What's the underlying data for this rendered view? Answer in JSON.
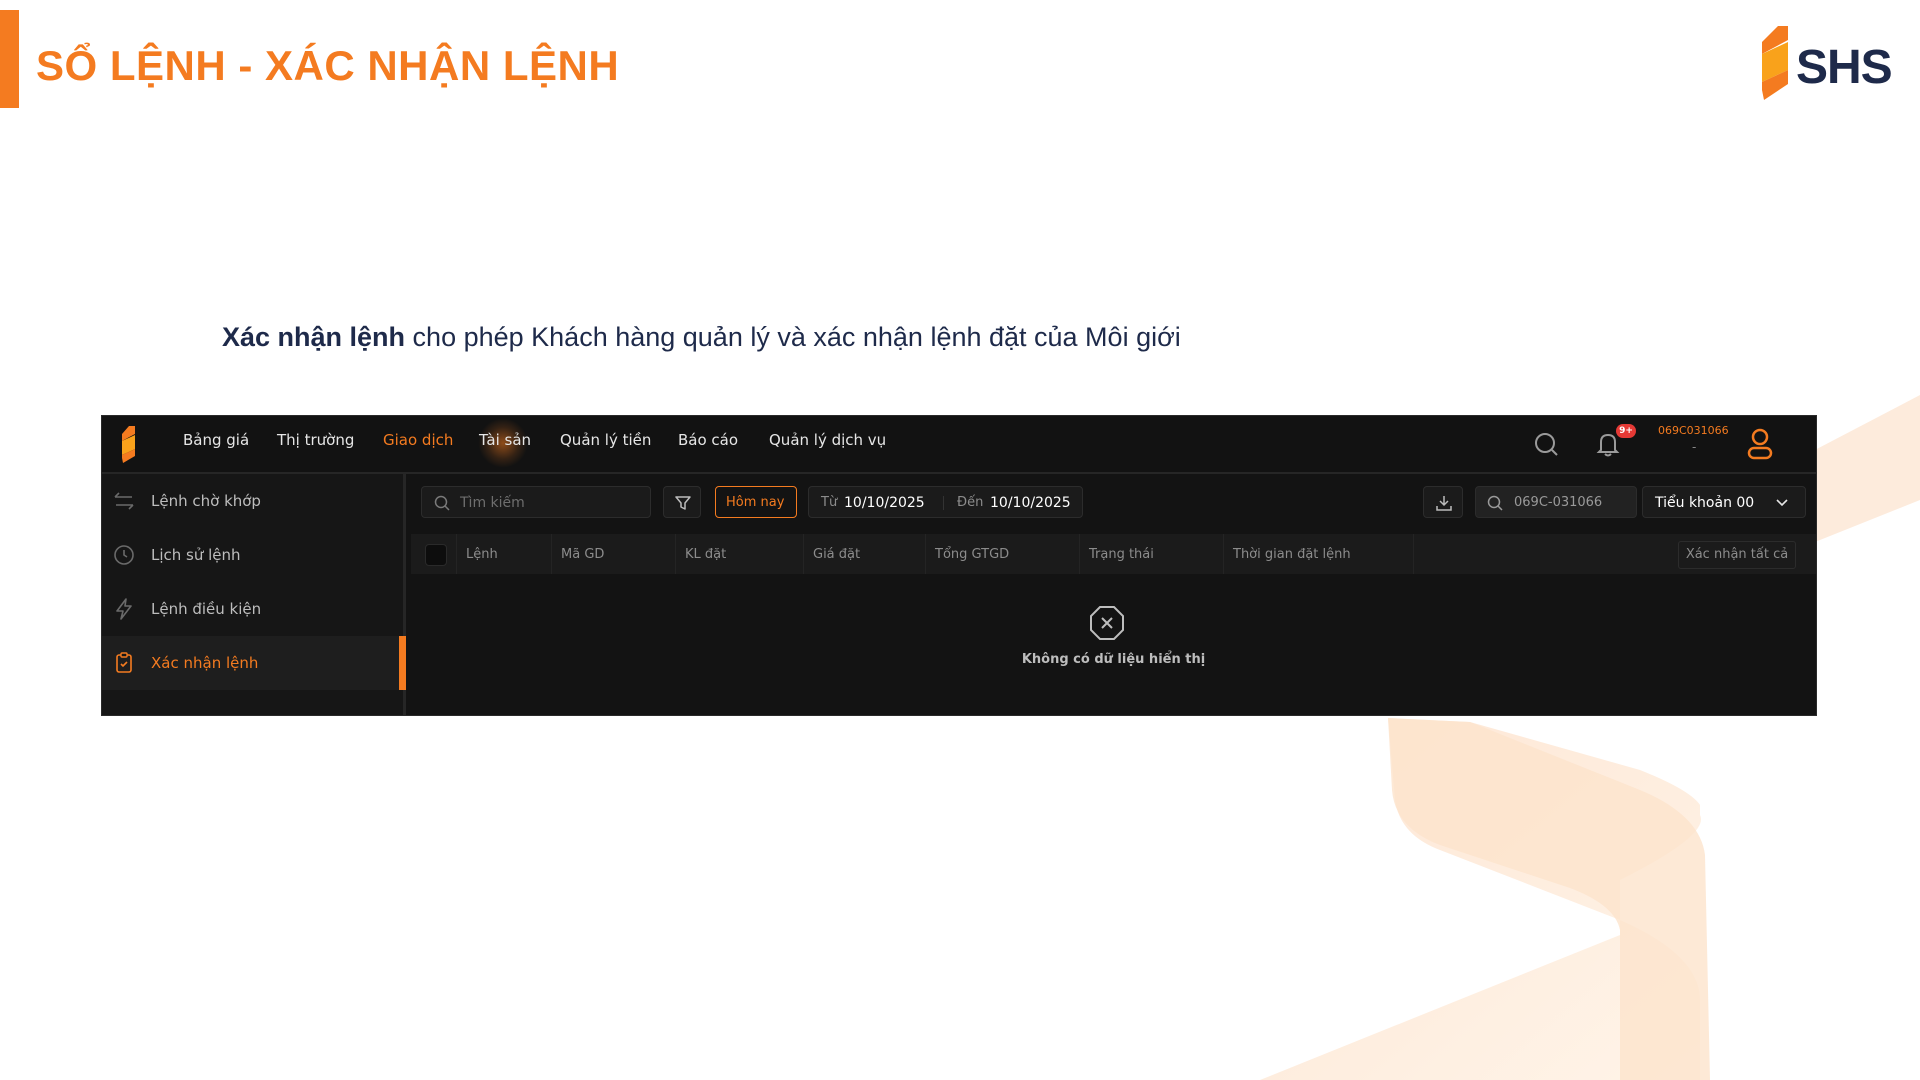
{
  "slide": {
    "title": "SỔ LỆNH - XÁC NHẬN LỆNH",
    "logo_text": "SHS",
    "intro_bold": "Xác nhận lệnh",
    "intro_rest": " cho phép Khách hàng quản lý và xác nhận lệnh đặt của Môi giới",
    "accent_color": "#f47b20"
  },
  "app": {
    "nav": [
      "Bảng giá",
      "Thị trường",
      "Giao dịch",
      "Tài sản",
      "Quản lý tiền",
      "Báo cáo",
      "Quản lý dịch vụ"
    ],
    "active_nav": "Giao dịch",
    "notification_badge": "9+",
    "account_code": "069C031066",
    "account_sub": "-",
    "sidebar": [
      {
        "label": "Lệnh chờ khớp",
        "icon": "swap-arrows-icon"
      },
      {
        "label": "Lịch sử lệnh",
        "icon": "clock-icon"
      },
      {
        "label": "Lệnh điều kiện",
        "icon": "lightning-icon"
      },
      {
        "label": "Xác nhận lệnh",
        "icon": "clipboard-check-icon",
        "active": true
      }
    ],
    "toolbar": {
      "search_placeholder": "Tìm kiếm",
      "today_label": "Hôm nay",
      "from_label": "Từ",
      "from_date": "10/10/2025",
      "to_label": "Đến",
      "to_date": "10/10/2025",
      "account_search_value": "069C-031066",
      "subaccount_label": "Tiểu khoản 00"
    },
    "table": {
      "columns": [
        "Lệnh",
        "Mã GD",
        "KL đặt",
        "Giá đặt",
        "Tổng GTGD",
        "Trạng thái",
        "Thời gian đặt lệnh"
      ],
      "confirm_all_label": "Xác nhận tất cả",
      "empty_message": "Không có dữ liệu hiển thị"
    }
  }
}
